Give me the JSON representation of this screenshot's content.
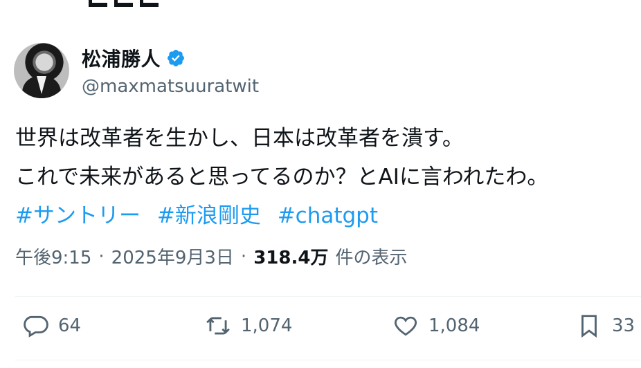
{
  "author": {
    "display_name": "松浦勝人",
    "handle": "@maxmatsuuratwit",
    "verified": true,
    "avatar_icon": "profile-photo"
  },
  "tweet": {
    "lines": [
      "世界は改革者を生かし、日本は改革者を潰す。",
      "これで未来があると思ってるのか？とAIに言われたわ。"
    ],
    "hashtags": [
      "#サントリー",
      "#新浪剛史",
      "#chatgpt"
    ]
  },
  "meta": {
    "time": "午後9:15",
    "separator": "·",
    "date": "2025年9月3日",
    "views_count": "318.4万",
    "views_label": "件の表示"
  },
  "actions": {
    "replies": "64",
    "reposts": "1,074",
    "likes": "1,084",
    "bookmarks": "33"
  },
  "colors": {
    "text": "#0f1419",
    "secondary": "#536471",
    "accent": "#1d9bf0",
    "divider": "#eff3f4"
  }
}
